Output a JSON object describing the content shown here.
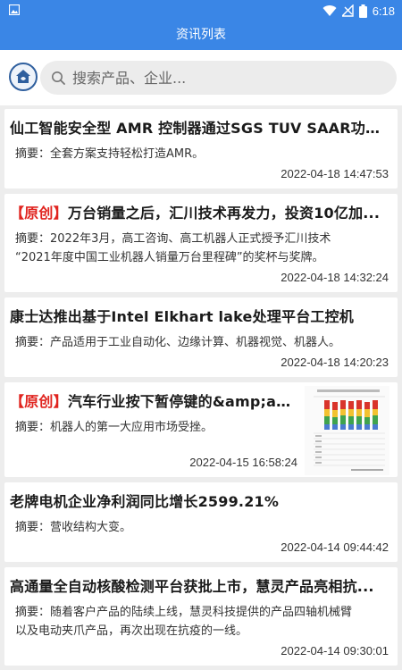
{
  "status_bar": {
    "time": "6:18",
    "icons": [
      "image-icon",
      "wifi-icon",
      "signal-icon",
      "battery-icon"
    ]
  },
  "app_bar": {
    "title": "资讯列表"
  },
  "search": {
    "placeholder": "搜索产品、企业..."
  },
  "colors": {
    "accent": "#3a86e6",
    "tag_red": "#e0241f"
  },
  "articles": [
    {
      "title": "仙工智能安全型 AMR 控制器通过SGS TUV SAAR功能安...",
      "summary_lines": [
        "摘要：全套方案支持轻松打造AMR。"
      ],
      "time": "2022-04-18 14:47:53"
    },
    {
      "tag": "【原创】",
      "title": "万台销量之后，汇川技术再发力，投资10亿加...",
      "summary_lines": [
        "摘要：2022年3月，高工咨询、高工机器人正式授予汇川技术",
        "“2021年度中国工业机器人销量万台里程碑”的奖杯与奖牌。"
      ],
      "time": "2022-04-18 14:32:24"
    },
    {
      "title": "康士达推出基于Intel Elkhart lake处理平台工控机",
      "summary_lines": [
        "摘要：产品适用于工业自动化、边缘计算、机器视觉、机器人。"
      ],
      "time": "2022-04-18 14:20:23"
    },
    {
      "tag": "【原创】",
      "title": "汽车行业按下暂停键的&amp;amp...",
      "summary_lines": [
        "摘要：机器人的第一大应用市场受挫。"
      ],
      "time": "2022-04-15 16:58:24",
      "has_thumbnail": true
    },
    {
      "title": "老牌电机企业净利润同比增长2599.21%",
      "summary_lines": [
        "摘要：营收结构大变。"
      ],
      "time": "2022-04-14 09:44:42"
    },
    {
      "title": "高通量全自动核酸检测平台获批上市，慧灵产品亮相抗...",
      "summary_lines": [
        "摘要：随着客户产品的陆续上线，慧灵科技提供的产品四轴机械臂",
        "以及电动夹爪产品，再次出现在抗疫的一线。"
      ],
      "time": "2022-04-14 09:30:01"
    }
  ]
}
